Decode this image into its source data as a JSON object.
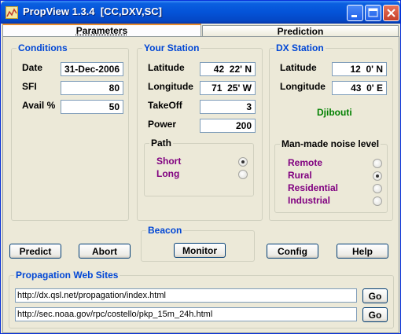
{
  "window": {
    "title": "PropView 1.3.4  [CC,DXV,SC]"
  },
  "tabs": [
    {
      "label": "Parameters",
      "selected": true
    },
    {
      "label": "Prediction",
      "selected": false
    }
  ],
  "conditions": {
    "title": "Conditions",
    "date_label": "Date",
    "date_value": "31-Dec-2006",
    "sfi_label": "SFI",
    "sfi_value": "80",
    "avail_label": "Avail %",
    "avail_value": "50"
  },
  "your_station": {
    "title": "Your Station",
    "latitude_label": "Latitude",
    "latitude_value": "42  22' N",
    "longitude_label": "Longitude",
    "longitude_value": "71  25' W",
    "takeoff_label": "TakeOff",
    "takeoff_value": "3",
    "power_label": "Power",
    "power_value": "200",
    "path": {
      "title": "Path",
      "options": [
        {
          "label": "Short",
          "checked": true
        },
        {
          "label": "Long",
          "checked": false
        }
      ]
    }
  },
  "dx_station": {
    "title": "DX Station",
    "latitude_label": "Latitude",
    "latitude_value": "12  0' N",
    "longitude_label": "Longitude",
    "longitude_value": "43  0' E",
    "country": "Djibouti"
  },
  "noise": {
    "title": "Man-made noise level",
    "options": [
      {
        "label": "Remote",
        "checked": false
      },
      {
        "label": "Rural",
        "checked": true
      },
      {
        "label": "Residential",
        "checked": false
      },
      {
        "label": "Industrial",
        "checked": false
      }
    ]
  },
  "beacon": {
    "title": "Beacon",
    "monitor_label": "Monitor"
  },
  "buttons": {
    "predict": "Predict",
    "abort": "Abort",
    "config": "Config",
    "help": "Help"
  },
  "web_sites": {
    "title": "Propagation Web Sites",
    "urls": [
      "http://dx.qsl.net/propagation/index.html",
      "http://sec.noaa.gov/rpc/costello/pkp_15m_24h.html"
    ],
    "go_label": "Go"
  },
  "colors": {
    "group_title": "#0046d5",
    "radio_text": "#800080",
    "country": "#008000",
    "titlebar": "#0453d8"
  }
}
